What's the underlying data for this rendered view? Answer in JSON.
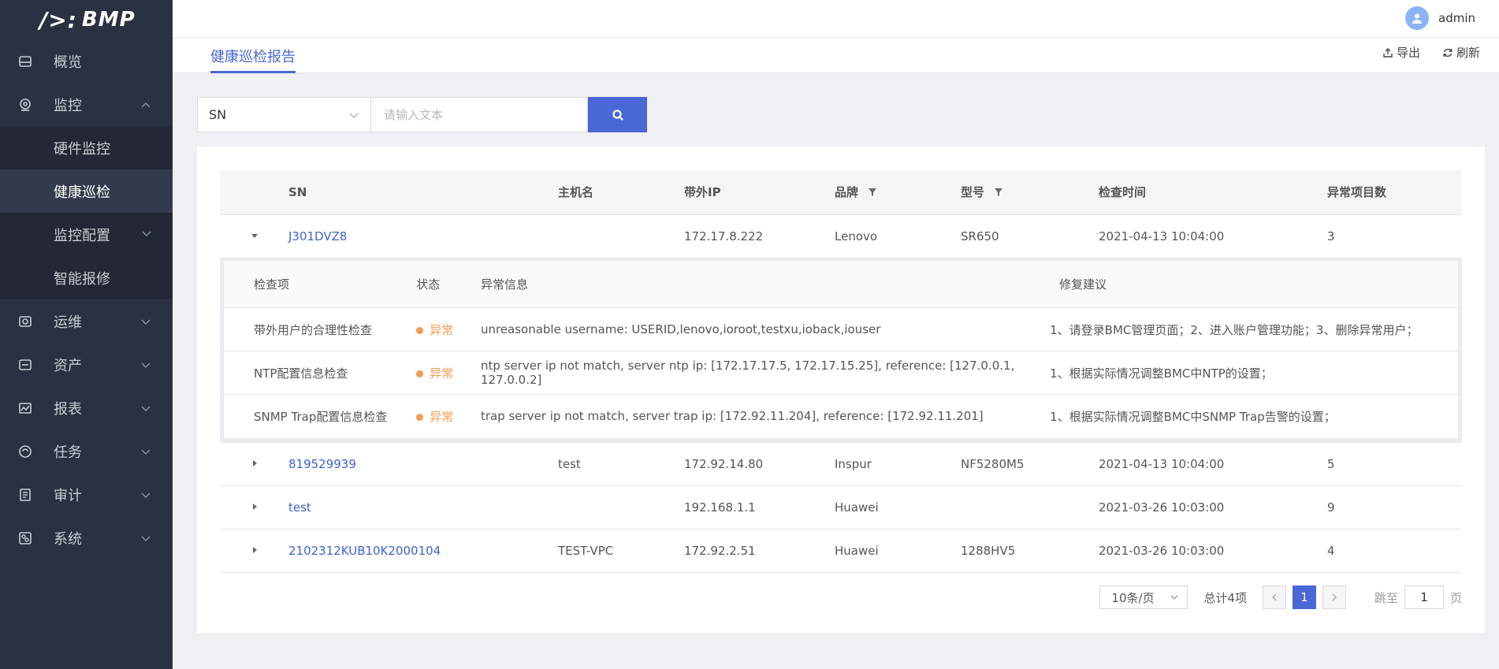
{
  "app": {
    "logo_text": "BMP",
    "logo_mark": "/>:"
  },
  "user": {
    "name": "admin"
  },
  "sidebar": {
    "items": [
      {
        "label": "概览"
      },
      {
        "label": "监控"
      },
      {
        "label": "运维"
      },
      {
        "label": "资产"
      },
      {
        "label": "报表"
      },
      {
        "label": "任务"
      },
      {
        "label": "审计"
      },
      {
        "label": "系统"
      }
    ],
    "sub_items": [
      {
        "label": "硬件监控"
      },
      {
        "label": "健康巡检"
      },
      {
        "label": "监控配置"
      },
      {
        "label": "智能报修"
      }
    ]
  },
  "header": {
    "tab": "健康巡检报告",
    "export": "导出",
    "refresh": "刷新"
  },
  "search": {
    "field": "SN",
    "placeholder": "请输入文本"
  },
  "table": {
    "columns": [
      "SN",
      "主机名",
      "带外IP",
      "品牌",
      "型号",
      "检查时间",
      "异常项目数"
    ],
    "rows": [
      {
        "sn": "J301DVZ8",
        "host": "",
        "ip": "172.17.8.222",
        "brand": "Lenovo",
        "model": "SR650",
        "time": "2021-04-13 10:04:00",
        "count": "3"
      },
      {
        "sn": "819529939",
        "host": "test",
        "ip": "172.92.14.80",
        "brand": "Inspur",
        "model": "NF5280M5",
        "time": "2021-04-13 10:04:00",
        "count": "5"
      },
      {
        "sn": "test",
        "host": "",
        "ip": "192.168.1.1",
        "brand": "Huawei",
        "model": "",
        "time": "2021-03-26 10:03:00",
        "count": "9"
      },
      {
        "sn": "2102312KUB10K2000104",
        "host": "TEST-VPC",
        "ip": "172.92.2.51",
        "brand": "Huawei",
        "model": "1288HV5",
        "time": "2021-03-26 10:03:00",
        "count": "4"
      }
    ]
  },
  "detail": {
    "columns": [
      "检查项",
      "状态",
      "异常信息",
      "修复建议"
    ],
    "rows": [
      {
        "item": "带外用户的合理性检查",
        "status": "异常",
        "info": "unreasonable username: USERID,lenovo,ioroot,testxu,ioback,iouser",
        "fix": "1、请登录BMC管理页面；2、进入账户管理功能；3、删除异常用户；"
      },
      {
        "item": "NTP配置信息检查",
        "status": "异常",
        "info": "ntp server ip not match, server ntp ip: [172.17.17.5, 172.17.15.25], reference: [127.0.0.1, 127.0.0.2]",
        "fix": "1、根据实际情况调整BMC中NTP的设置；"
      },
      {
        "item": "SNMP Trap配置信息检查",
        "status": "异常",
        "info": "trap server ip not match, server trap ip: [172.92.11.204], reference: [172.92.11.201]",
        "fix": "1、根据实际情况调整BMC中SNMP Trap告警的设置；"
      }
    ]
  },
  "pager": {
    "page_size": "10条/页",
    "total": "总计4项",
    "current": "1",
    "jump_label": "跳至",
    "jump_value": "1",
    "page_unit": "页"
  },
  "colors": {
    "accent": "#4a67d6",
    "link": "#3f63d0",
    "warn": "#f59a4e",
    "sidebar_bg": "#2c3142"
  }
}
